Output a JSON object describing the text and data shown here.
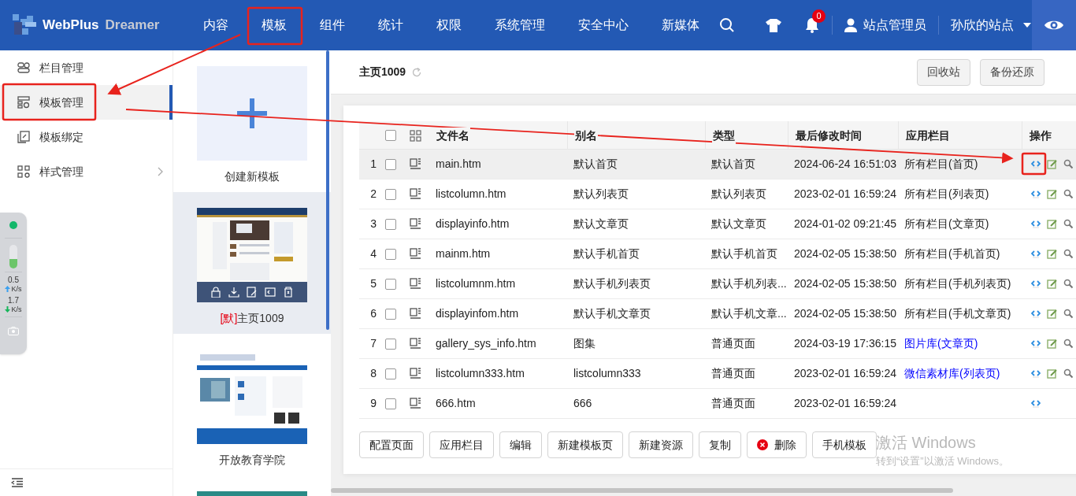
{
  "brand": {
    "name": "WebPlus",
    "product": "Dreamer"
  },
  "nav": [
    "内容",
    "模板",
    "组件",
    "统计",
    "权限",
    "系统管理",
    "安全中心",
    "新媒体"
  ],
  "header": {
    "notification_count": "0",
    "user": "站点管理员",
    "site": "孙欣的站点"
  },
  "sidebar": {
    "items": [
      {
        "label": "栏目管理",
        "selected": false,
        "has_submenu": false
      },
      {
        "label": "模板管理",
        "selected": true,
        "has_submenu": false
      },
      {
        "label": "模板绑定",
        "selected": false,
        "has_submenu": false
      },
      {
        "label": "样式管理",
        "selected": false,
        "has_submenu": true
      }
    ]
  },
  "network_widget": {
    "upload": "0.5",
    "upload_unit": "K/s",
    "download": "1.7",
    "download_unit": "K/s"
  },
  "templates": {
    "create_label": "创建新模板",
    "items": [
      {
        "default_mark": "[默]",
        "name": "主页1009",
        "selected": true,
        "toolbar": true
      },
      {
        "name": "开放教育学院",
        "selected": false
      },
      {
        "selected": false
      }
    ]
  },
  "page": {
    "title": "主页1009",
    "buttons": [
      "回收站",
      "备份还原"
    ]
  },
  "table": {
    "columns": [
      "文件名",
      "别名",
      "类型",
      "最后修改时间",
      "应用栏目",
      "操作"
    ],
    "header_checked": false,
    "rows": [
      {
        "index": "1",
        "checked": false,
        "highlighted": true,
        "file": "main.htm",
        "alias": "默认首页",
        "type": "默认首页",
        "modified": "2024-06-24 16:51:03",
        "column": "所有栏目(首页)",
        "linked": false,
        "actions": [
          {
            "kind": "code"
          },
          {
            "kind": "edit"
          },
          {
            "kind": "view"
          }
        ]
      },
      {
        "index": "2",
        "checked": false,
        "highlighted": false,
        "file": "listcolumn.htm",
        "alias": "默认列表页",
        "type": "默认列表页",
        "modified": "2023-02-01 16:59:24",
        "column": "所有栏目(列表页)",
        "linked": false,
        "actions": [
          {
            "kind": "code"
          },
          {
            "kind": "edit"
          },
          {
            "kind": "view"
          }
        ]
      },
      {
        "index": "3",
        "checked": false,
        "highlighted": false,
        "file": "displayinfo.htm",
        "alias": "默认文章页",
        "type": "默认文章页",
        "modified": "2024-01-02 09:21:45",
        "column": "所有栏目(文章页)",
        "linked": false,
        "actions": [
          {
            "kind": "code"
          },
          {
            "kind": "edit"
          },
          {
            "kind": "view"
          }
        ]
      },
      {
        "index": "4",
        "checked": false,
        "highlighted": false,
        "file": "mainm.htm",
        "alias": "默认手机首页",
        "type": "默认手机首页",
        "modified": "2024-02-05 15:38:50",
        "column": "所有栏目(手机首页)",
        "linked": false,
        "actions": [
          {
            "kind": "code"
          },
          {
            "kind": "edit"
          },
          {
            "kind": "view"
          }
        ]
      },
      {
        "index": "5",
        "checked": false,
        "highlighted": false,
        "file": "listcolumnm.htm",
        "alias": "默认手机列表页",
        "type": "默认手机列表...",
        "modified": "2024-02-05 15:38:50",
        "column": "所有栏目(手机列表页)",
        "linked": false,
        "actions": [
          {
            "kind": "code"
          },
          {
            "kind": "edit"
          },
          {
            "kind": "view"
          }
        ]
      },
      {
        "index": "6",
        "checked": false,
        "highlighted": false,
        "file": "displayinfom.htm",
        "alias": "默认手机文章页",
        "type": "默认手机文章...",
        "modified": "2024-02-05 15:38:50",
        "column": "所有栏目(手机文章页)",
        "linked": false,
        "actions": [
          {
            "kind": "code"
          },
          {
            "kind": "edit"
          },
          {
            "kind": "view"
          }
        ]
      },
      {
        "index": "7",
        "checked": false,
        "highlighted": false,
        "file": "gallery_sys_info.htm",
        "alias": "图集",
        "type": "普通页面",
        "modified": "2024-03-19 17:36:15",
        "column": "图片库(文章页)",
        "linked": true,
        "actions": [
          {
            "kind": "code"
          },
          {
            "kind": "edit"
          },
          {
            "kind": "view"
          }
        ]
      },
      {
        "index": "8",
        "checked": false,
        "highlighted": false,
        "file": "listcolumn333.htm",
        "alias": "listcolumn333",
        "type": "普通页面",
        "modified": "2023-02-01 16:59:24",
        "column": "微信素材库(列表页)",
        "linked": true,
        "actions": [
          {
            "kind": "code"
          },
          {
            "kind": "edit"
          },
          {
            "kind": "view"
          }
        ]
      },
      {
        "index": "9",
        "checked": false,
        "highlighted": false,
        "file": "666.htm",
        "alias": "666",
        "type": "普通页面",
        "modified": "2023-02-01 16:59:24",
        "actions": [
          {
            "kind": "code"
          }
        ]
      }
    ]
  },
  "actions": [
    {
      "label": "配置页面",
      "kind": "plain"
    },
    {
      "label": "应用栏目",
      "kind": "plain"
    },
    {
      "label": "编辑",
      "kind": "plain"
    },
    {
      "label": "新建模板页",
      "kind": "plain"
    },
    {
      "label": "新建资源",
      "kind": "plain"
    },
    {
      "label": "复制",
      "kind": "plain"
    },
    {
      "label": "删除",
      "kind": "danger"
    },
    {
      "label": "手机模板",
      "kind": "plain"
    }
  ],
  "activation_notice": {
    "title": "激活 Windows",
    "hint": "转到“设置”以激活 Windows。"
  }
}
